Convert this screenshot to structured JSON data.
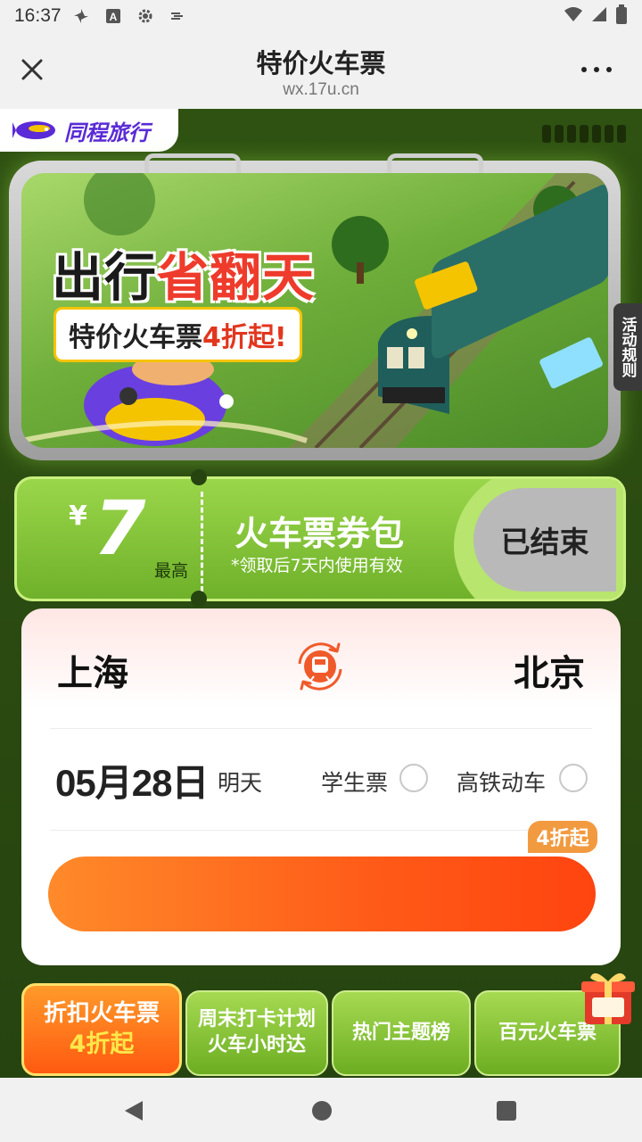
{
  "status_bar": {
    "time": "16:37",
    "icons": [
      "pinwheel-icon",
      "a-box-icon",
      "gear-icon",
      "data-saver-icon",
      "wifi-icon",
      "signal-icon",
      "battery-icon"
    ]
  },
  "title_bar": {
    "title": "特价火车票",
    "url": "wx.17u.cn"
  },
  "brand": {
    "logo_text": "同程旅行"
  },
  "banner": {
    "title_black": "出行",
    "title_red": "省翻天",
    "subtitle_prefix": "特价火车票",
    "subtitle_highlight": "4折起!",
    "rules_tab": "活动规则"
  },
  "coupon": {
    "currency": "¥",
    "amount": "7",
    "max_label": "最高",
    "title": "火车票券包",
    "note": "*领取后7天内使用有效",
    "status": "已结束"
  },
  "search_form": {
    "from_city": "上海",
    "to_city": "北京",
    "date": "05月28日",
    "day_label": "明天",
    "student_ticket": "学生票",
    "high_speed": "高铁动车",
    "discount_tag": "4折起"
  },
  "tabs": [
    {
      "line1": "折扣火车票",
      "line2": "4折起"
    },
    {
      "line1": "周末打卡计划",
      "line2": "火车小时达"
    },
    {
      "line1": "热门主题榜",
      "line2": ""
    },
    {
      "line1": "百元火车票",
      "line2": ""
    }
  ],
  "colors": {
    "page_green": "#2a4a0e",
    "coupon_green": "#8ccd3c",
    "search_orange": "#ff5a18",
    "brand_purple": "#5a2bd6",
    "accent_red": "#ee3b2b"
  }
}
